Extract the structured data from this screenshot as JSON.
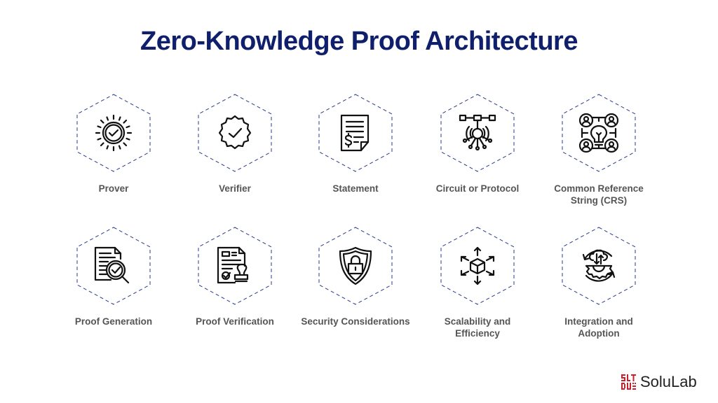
{
  "title": "Zero-Knowledge Proof Architecture",
  "colors": {
    "title": "#0f1f6b",
    "hex_border": "#2a3a8c",
    "label": "#555555",
    "logo_red": "#c8202c"
  },
  "items": [
    {
      "label": "Prover",
      "icon": "sun-check-icon"
    },
    {
      "label": "Verifier",
      "icon": "verified-badge-icon"
    },
    {
      "label": "Statement",
      "icon": "document-dollar-icon"
    },
    {
      "label": "Circuit or Protocol",
      "icon": "circuit-network-icon"
    },
    {
      "label": "Common Reference String (CRS)",
      "icon": "people-lightbulb-icon"
    },
    {
      "label": "Proof Generation",
      "icon": "document-magnifier-check-icon"
    },
    {
      "label": "Proof Verification",
      "icon": "document-stamp-icon"
    },
    {
      "label": "Security Considerations",
      "icon": "shield-lock-icon"
    },
    {
      "label": "Scalability and Efficiency",
      "icon": "cube-arrows-icon"
    },
    {
      "label": "Integration and Adoption",
      "icon": "cloud-gear-cycle-icon"
    }
  ],
  "logo": {
    "text": "SoluLab"
  }
}
